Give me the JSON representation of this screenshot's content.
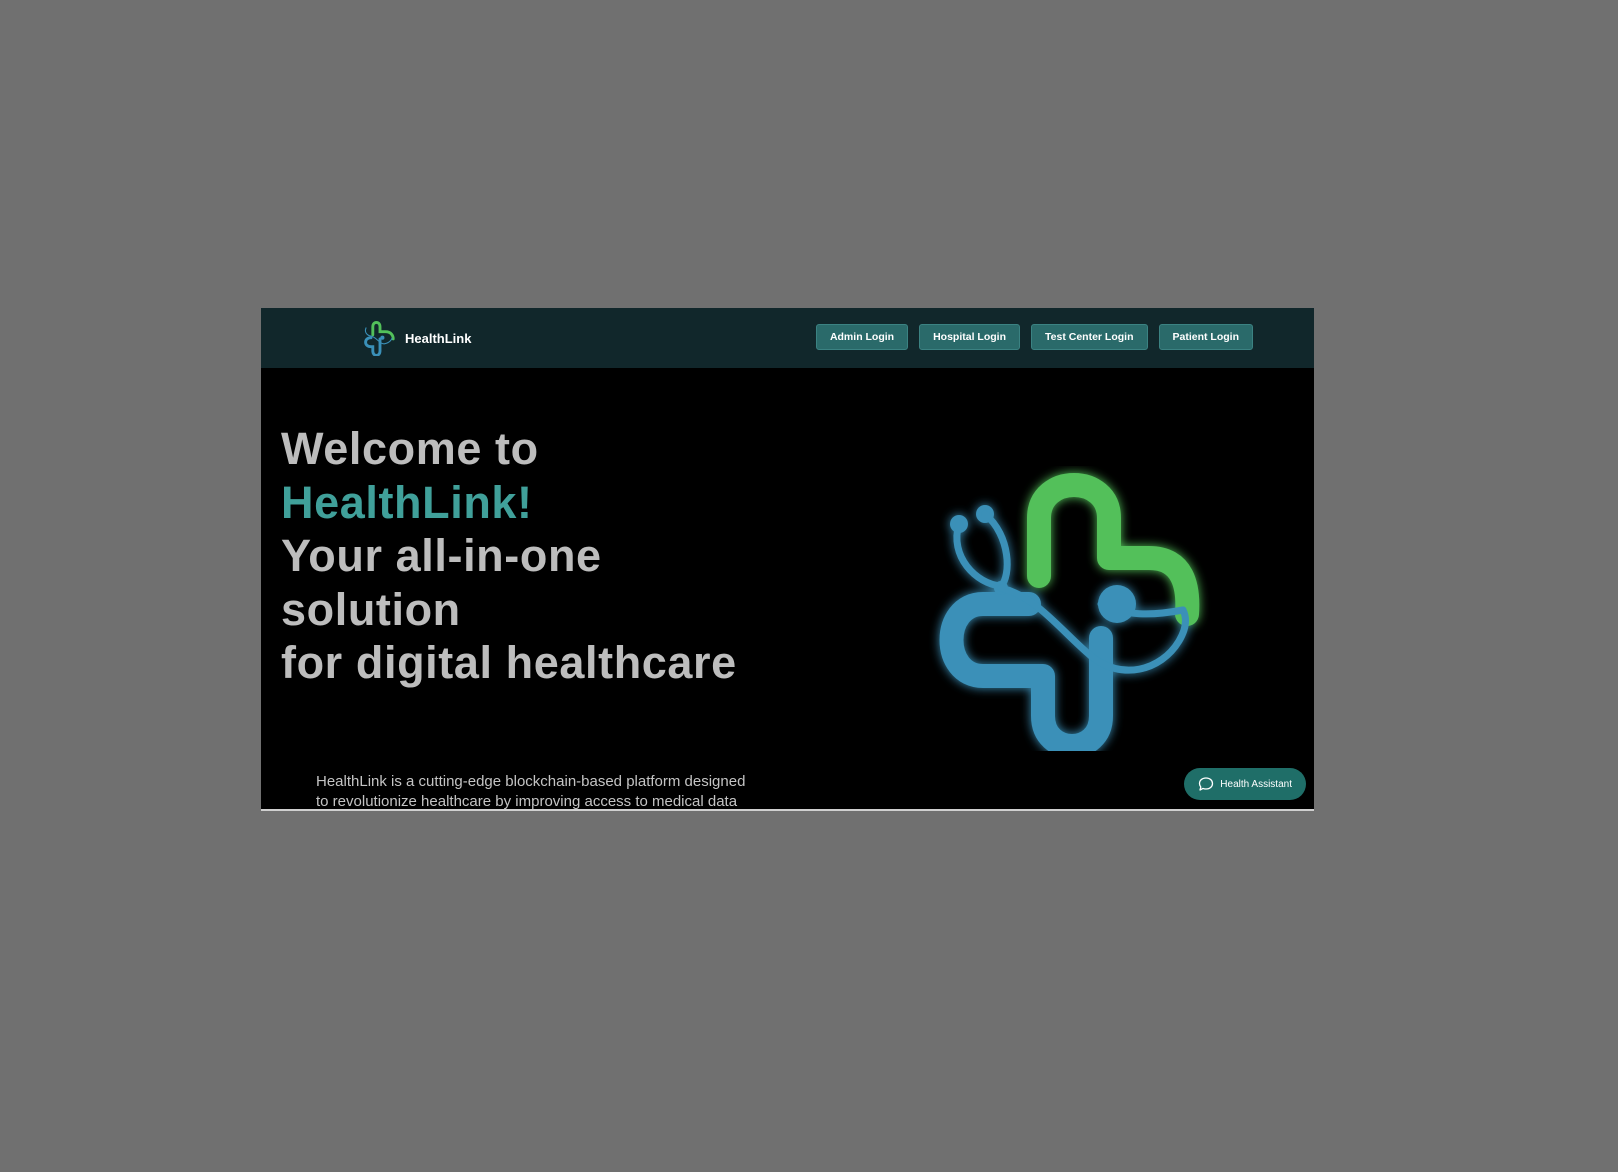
{
  "header": {
    "brand_name": "HealthLink",
    "logo_icon": "medical-cross-stethoscope-icon",
    "nav_buttons": [
      {
        "label": "Admin Login"
      },
      {
        "label": "Hospital Login"
      },
      {
        "label": "Test Center Login"
      },
      {
        "label": "Patient Login"
      }
    ]
  },
  "hero": {
    "line1": "Welcome to",
    "line2": "HealthLink!",
    "line3": "Your all-in-one",
    "line4": "solution",
    "line5": "for digital healthcare",
    "description_line1": "HealthLink is a cutting-edge blockchain-based platform designed",
    "description_line2": "to revolutionize healthcare by improving access to medical data"
  },
  "assistant": {
    "label": "Health Assistant",
    "icon": "chat-bubble-icon"
  },
  "colors": {
    "accent": "#40a09a",
    "navbar_bg": "#11272b",
    "button_bg": "#2a6a6a",
    "logo_green": "#52c05a",
    "logo_blue": "#3a90b8"
  }
}
